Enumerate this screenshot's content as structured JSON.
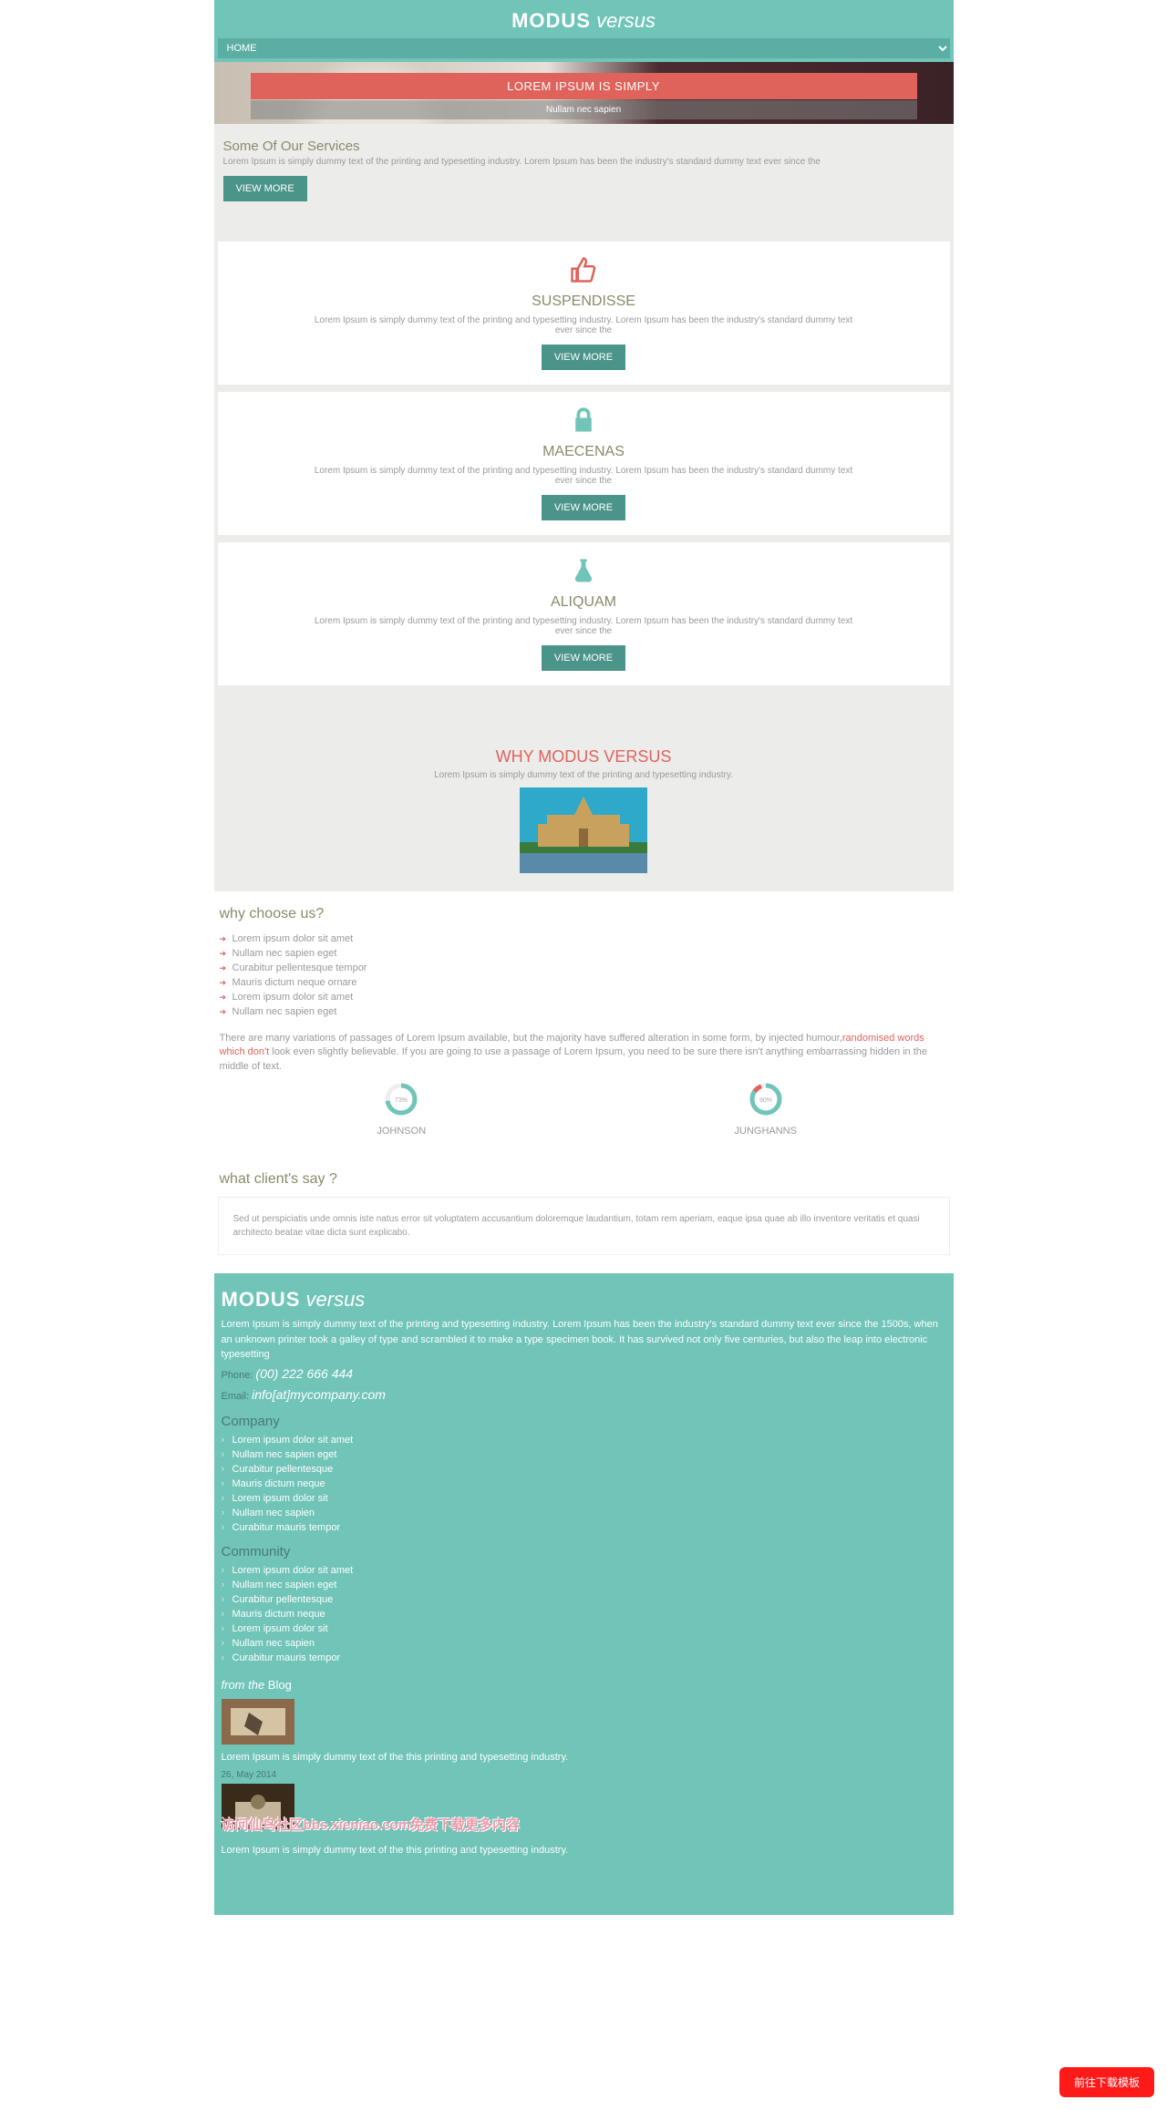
{
  "header": {
    "logo_bold": "MODUS",
    "logo_light": " versus",
    "nav_selected": "HOME"
  },
  "hero": {
    "title": "LOREM IPSUM IS SIMPLY",
    "subtitle": "Nullam nec sapien"
  },
  "services_intro": {
    "heading": "Some Of Our Services",
    "desc": "Lorem Ipsum is simply dummy text of the printing and typesetting industry. Lorem Ipsum has been the industry's standard dummy text ever since the",
    "btn": "VIEW MORE"
  },
  "cards": [
    {
      "icon": "thumb",
      "title": "SUSPENDISSE",
      "desc": "Lorem Ipsum is simply dummy text of the printing and typesetting industry. Lorem Ipsum has been the industry's standard dummy text ever since the",
      "btn": "VIEW MORE"
    },
    {
      "icon": "lock",
      "title": "MAECENAS",
      "desc": "Lorem Ipsum is simply dummy text of the printing and typesetting industry. Lorem Ipsum has been the industry's standard dummy text ever since the",
      "btn": "VIEW MORE"
    },
    {
      "icon": "flask",
      "title": "ALIQUAM",
      "desc": "Lorem Ipsum is simply dummy text of the printing and typesetting industry. Lorem Ipsum has been the industry's standard dummy text ever since the",
      "btn": "VIEW MORE"
    }
  ],
  "why": {
    "heading": "WHY MODUS VERSUS",
    "sub": "Lorem Ipsum is simply dummy text of the printing and typesetting industry."
  },
  "choose": {
    "heading": "why choose us?",
    "items": [
      "Lorem ipsum dolor sit amet",
      "Nullam nec sapien eget",
      "Curabitur pellentesque tempor",
      "Mauris dictum neque ornare",
      "Lorem ipsum dolor sit amet",
      "Nullam nec sapien eget"
    ],
    "variations_a": "There are many variations of passages of Lorem Ipsum available, but the majority have suffered alteration in some form, by injected humour,",
    "variations_b": "randomised words which don't",
    "variations_c": " look even slightly believable. If you are going to use a passage of Lorem Ipsum, you need to be sure there isn't anything embarrassing hidden in the middle of text."
  },
  "chart_data": {
    "type": "pie",
    "series": [
      {
        "name": "JOHNSON",
        "value": 73,
        "remainder": 27
      },
      {
        "name": "JUNGHANNS",
        "value": 90,
        "remainder": 10
      }
    ]
  },
  "testimonials": {
    "heading": "what client's say ?",
    "quote": "Sed ut perspiciatis unde omnis iste natus error sit voluptatem accusantium doloremque laudantium, totam rem aperiam, eaque ipsa quae ab illo inventore veritatis et quasi architecto beatae vitae dicta sunt explicabo."
  },
  "footer": {
    "logo_bold": "MODUS",
    "logo_light": " versus",
    "desc": "Lorem Ipsum is simply dummy text of the printing and typesetting industry. Lorem Ipsum has been the industry's standard dummy text ever since the 1500s, when an unknown printer took a galley of type and scrambled it to make a type specimen book. It has survived not only five centuries, but also the leap into electronic typesetting",
    "phone_label": "Phone: ",
    "phone": "(00) 222 666 444",
    "email_label": "Email: ",
    "email": "info[at]mycompany.com",
    "company_h": "Company",
    "company_items": [
      "Lorem ipsum dolor sit amet",
      "Nullam nec sapien eget",
      "Curabitur pellentesque",
      "Mauris dictum neque",
      "Lorem ipsum dolor sit",
      "Nullam nec sapien",
      "Curabitur mauris tempor"
    ],
    "community_h": "Community",
    "community_items": [
      "Lorem ipsum dolor sit amet",
      "Nullam nec sapien eget",
      "Curabitur pellentesque",
      "Mauris dictum neque",
      "Lorem ipsum dolor sit",
      "Nullam nec sapien",
      "Curabitur mauris tempor"
    ],
    "blog_from": "from the",
    "blog_label": "  Blog",
    "blog1_text": "Lorem Ipsum is simply dummy text of the this printing and typesetting industry.",
    "blog1_date": "26, May 2014",
    "blog2_text": "Lorem Ipsum is simply dummy text of the this printing and typesetting industry.",
    "overlay": "访问仙鸟社区bbs.xieniao.com免费下载更多内容"
  },
  "download_btn": "前往下载模板"
}
